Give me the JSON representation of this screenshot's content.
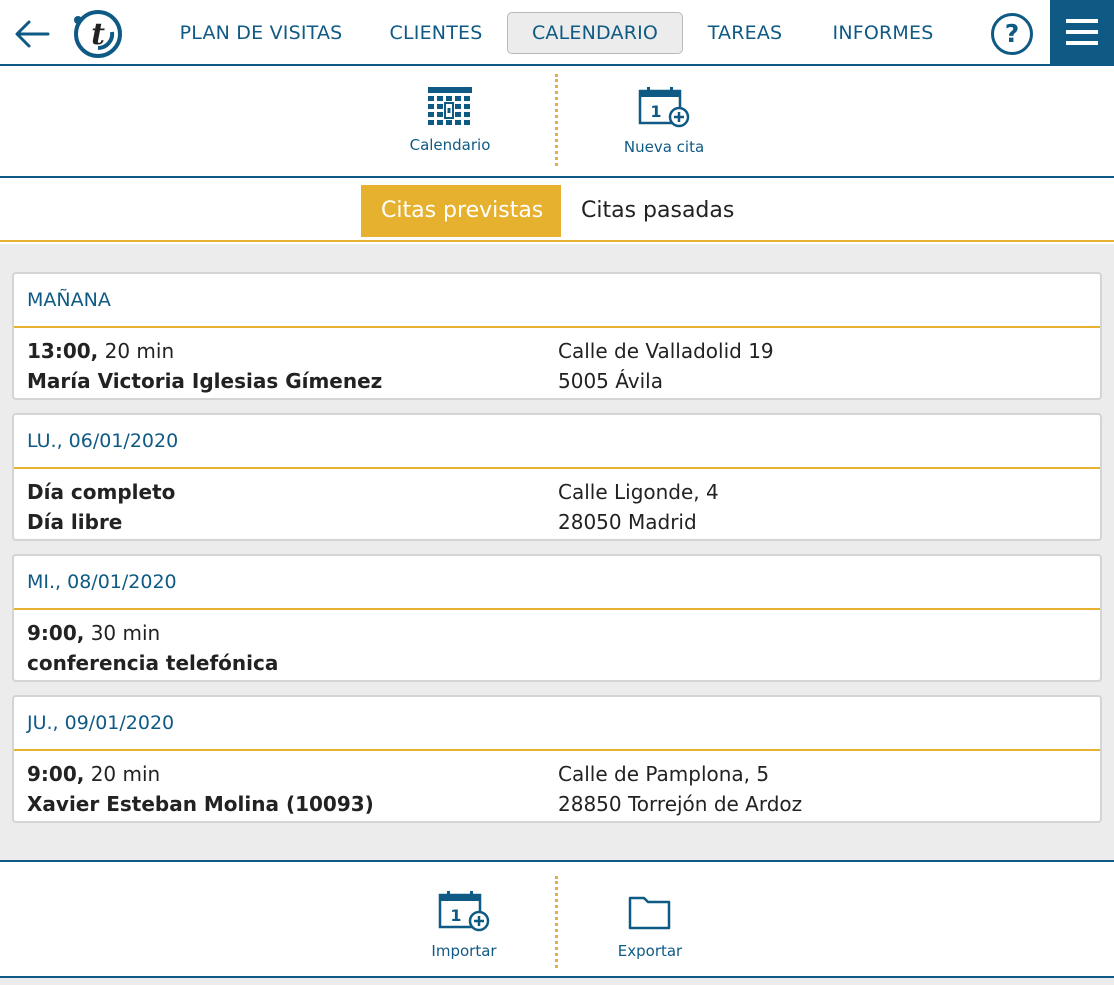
{
  "nav": {
    "items": [
      {
        "label": "PLAN DE VISITAS",
        "active": false
      },
      {
        "label": "CLIENTES",
        "active": false
      },
      {
        "label": "CALENDARIO",
        "active": true
      },
      {
        "label": "TAREAS",
        "active": false
      },
      {
        "label": "INFORMES",
        "active": false
      }
    ],
    "help_label": "?",
    "icons": {
      "back": "arrow-left-icon",
      "logo": "t-logo",
      "menu": "hamburger-menu-icon"
    }
  },
  "toolbar": {
    "calendar_label": "Calendario",
    "new_appointment_label": "Nueva cita"
  },
  "tabs": [
    {
      "label": "Citas previstas",
      "active": true
    },
    {
      "label": "Citas pasadas",
      "active": false
    }
  ],
  "appointments": [
    {
      "date": "MAÑANA",
      "time": "13:00,",
      "duration": " 20 min",
      "title": "María Victoria Iglesias Gímenez",
      "address1": "Calle de Valladolid 19",
      "address2": "5005 Ávila"
    },
    {
      "date": "LU., 06/01/2020",
      "time": "Día completo",
      "duration": "",
      "title": "Día libre",
      "address1": "Calle Ligonde, 4",
      "address2": "28050 Madrid"
    },
    {
      "date": "MI., 08/01/2020",
      "time": "9:00,",
      "duration": " 30 min",
      "title": "conferencia telefónica",
      "address1": "",
      "address2": ""
    },
    {
      "date": "JU., 09/01/2020",
      "time": "9:00,",
      "duration": " 20 min",
      "title": "Xavier Esteban Molina (10093)",
      "address1": "Calle de Pamplona, 5",
      "address2": "28850 Torrejón de Ardoz"
    }
  ],
  "bottom": {
    "import_label": "Importar",
    "export_label": "Exportar"
  },
  "colors": {
    "primary": "#0f5a85",
    "accent": "#e6b12e",
    "background": "#ececec"
  }
}
